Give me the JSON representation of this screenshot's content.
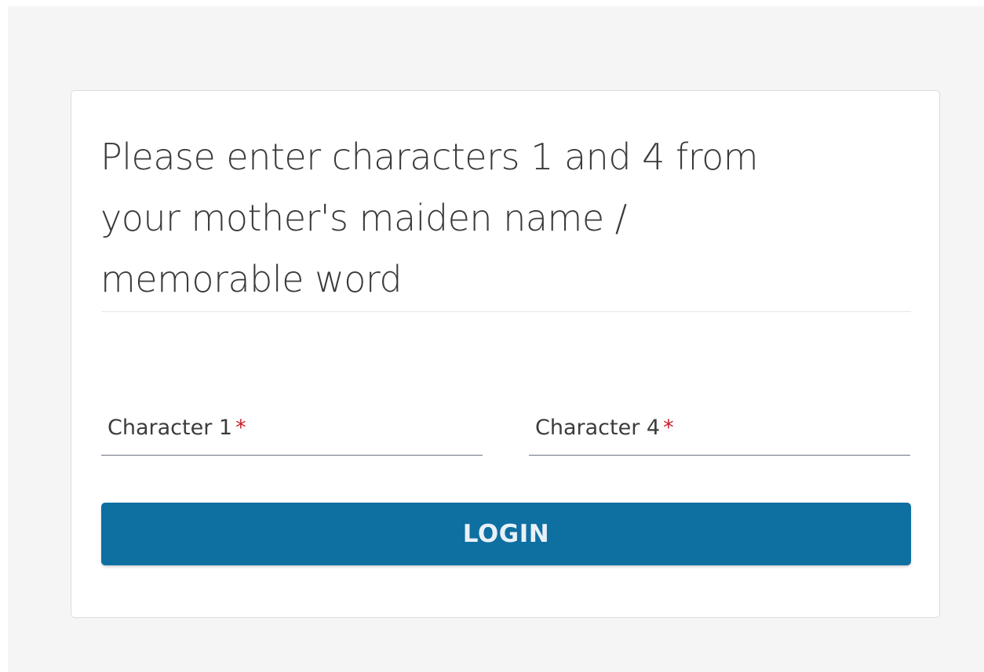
{
  "prompt": {
    "line1": "Please enter characters 1 and 4 from",
    "line2": "your mother's maiden name /",
    "line3": "memorable word"
  },
  "fields": [
    {
      "label": "Character 1",
      "required_mark": "*",
      "value": ""
    },
    {
      "label": "Character 4",
      "required_mark": "*",
      "value": ""
    }
  ],
  "login_button": {
    "label": "LOGIN"
  },
  "colors": {
    "page_background": "#f5f5f5",
    "card_background": "#ffffff",
    "button_background": "#0e6fa1",
    "button_text": "#e8f1f7",
    "required_mark": "#c8202a",
    "text": "#3a3a3a"
  }
}
